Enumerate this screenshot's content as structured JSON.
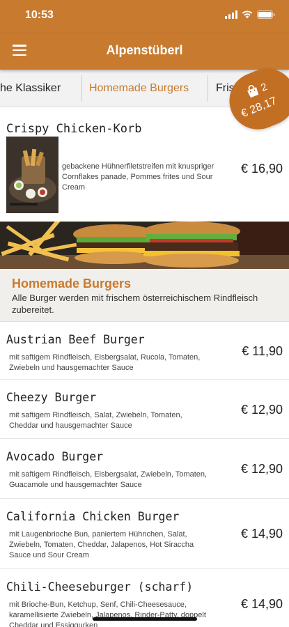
{
  "status_bar": {
    "time": "10:53"
  },
  "app_bar": {
    "title": "Alpenstüberl"
  },
  "categories": [
    {
      "label": "che Klassiker",
      "active": false
    },
    {
      "label": "Homemade Burgers",
      "active": true
    },
    {
      "label": "Fris",
      "active": false
    }
  ],
  "cart": {
    "count": "2",
    "total": "€ 28,17"
  },
  "featured_item": {
    "name": "Crispy Chicken-Korb",
    "description": "gebackene Hühnerfiletstreifen mit knuspriger Cornflakes panade, Pommes frites und Sour Cream",
    "price": "€ 16,90"
  },
  "section": {
    "title": "Homemade Burgers",
    "description": "Alle Burger werden mit frischem österreichischem Rindfleisch zubereitet."
  },
  "items": [
    {
      "name": "Austrian Beef Burger",
      "description": "mit saftigem Rindfleisch, Eisbergsalat, Rucola, Tomaten, Zwiebeln und hausgemachter Sauce",
      "price": "€ 11,90"
    },
    {
      "name": "Cheezy Burger",
      "description": "mit saftigem Rindfleisch, Salat, Zwiebeln, Tomaten, Cheddar und hausgemachter Sauce",
      "price": "€ 12,90"
    },
    {
      "name": "Avocado Burger",
      "description": "mit saftigem Rindfleisch, Eisbergsalat, Zwiebeln, Tomaten, Guacamole und hausgemachter Sauce",
      "price": "€ 12,90"
    },
    {
      "name": "California Chicken Burger",
      "description": "mit Laugenbrioche Bun, paniertem Hühnchen, Salat, Zwiebeln, Tomaten, Cheddar, Jalapenos, Hot Siraccha Sauce und Sour Cream",
      "price": "€ 14,90"
    },
    {
      "name": "Chili-Cheeseburger (scharf)",
      "description": "mit Brioche-Bun, Ketchup, Senf, Chili-Cheesesauce, karamellisierte Zwiebeln, Jalapenos, Rinder-Patty, doppelt Cheddar und Essiggurken",
      "price": "€ 14,90"
    }
  ],
  "colors": {
    "brand": "#c87a2e",
    "cart_badge": "#c26e23",
    "section_bg": "#f1efeb"
  },
  "icons": [
    "menu-icon",
    "signal-icon",
    "wifi-icon",
    "battery-icon",
    "shopping-bag-icon"
  ]
}
